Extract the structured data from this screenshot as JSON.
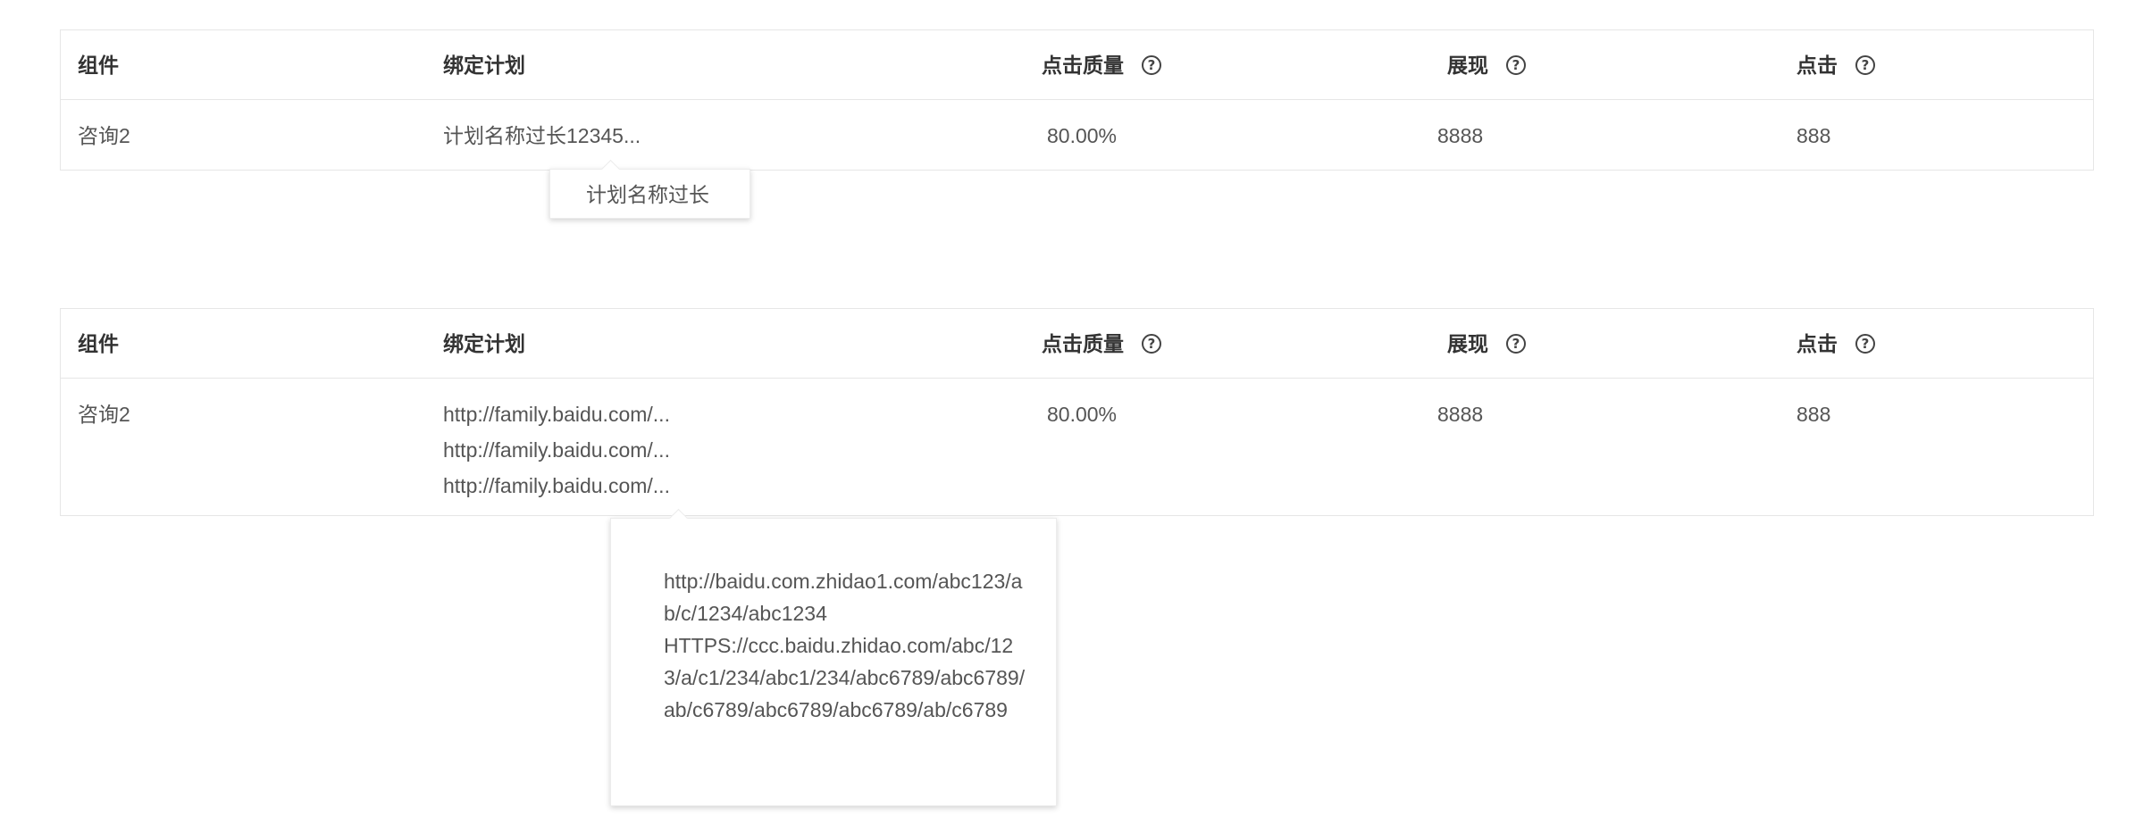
{
  "headers": {
    "component": "组件",
    "plan": "绑定计划",
    "click_quality": "点击质量",
    "impressions": "展现",
    "clicks": "点击",
    "help_glyph": "?"
  },
  "table1": {
    "row": {
      "component": "咨询2",
      "plan": "计划名称过长12345...",
      "click_quality": "80.00%",
      "impressions": "8888",
      "clicks": "888"
    },
    "tooltip": "计划名称过长"
  },
  "table2": {
    "row": {
      "component": "咨询2",
      "plans": [
        "http://family.baidu.com/...",
        "http://family.baidu.com/...",
        "http://family.baidu.com/..."
      ],
      "click_quality": "80.00%",
      "impressions": "8888",
      "clicks": "888"
    },
    "tooltip_lines": [
      "http://baidu.com.zhidao1.com/abc123/ab/c/1234/abc1234",
      "HTTPS://ccc.baidu.zhidao.com/abc/123/a/c1/234/abc1/234/abc6789/abc6789/ab/c6789/abc6789/abc6789/ab/c6789"
    ]
  }
}
